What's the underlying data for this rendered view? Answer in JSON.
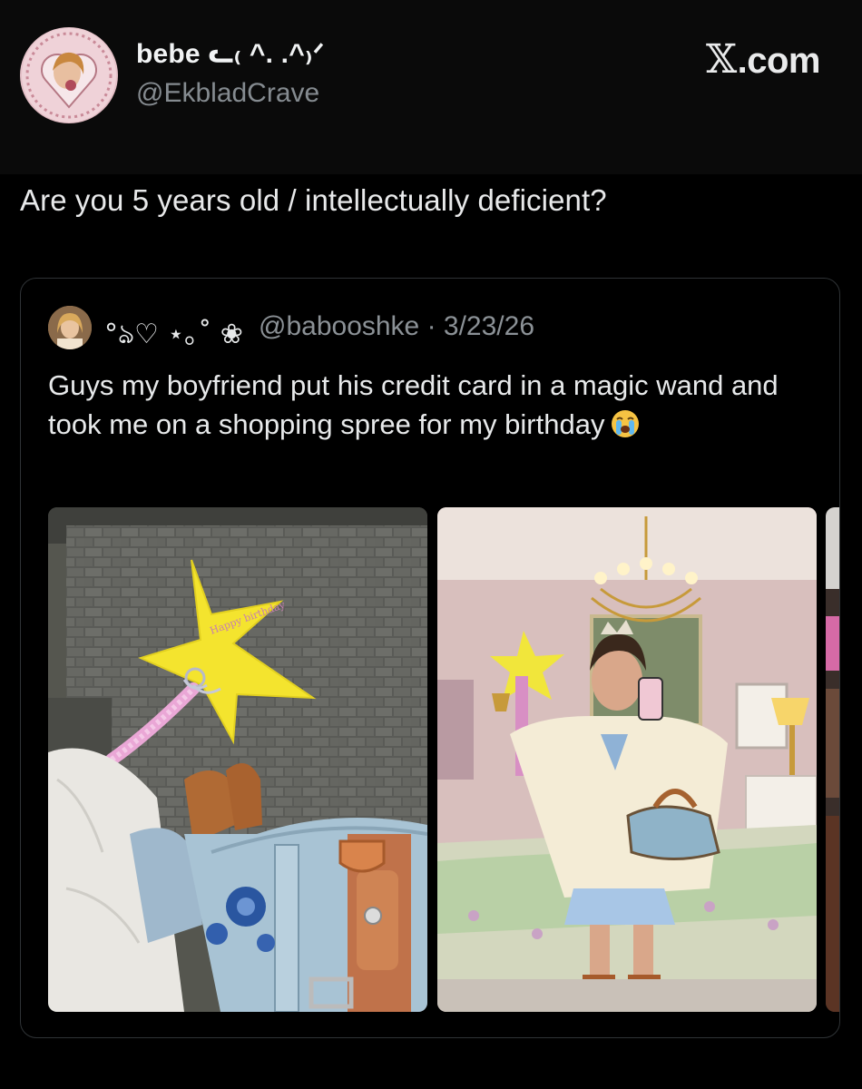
{
  "tweet": {
    "display_name": "bebe ᓚ₍ ^. .^₎ᐟ",
    "handle": "@EkbladCrave",
    "brand": "X.com",
    "text": "Are you 5 years old / intellectually deficient?"
  },
  "quoted_tweet": {
    "display_name": "°ঌ♡ ⋆｡˚ ❀",
    "handle_date": "@babooshke · 3/23/26",
    "text": "Guys my boyfriend put his credit card in a magic wand and took me on a shopping spree for my birthday",
    "emoji": "loudly-crying-face-emoji",
    "star_note": "Happy birthday",
    "images": [
      {
        "name": "wand-and-boots-photo"
      },
      {
        "name": "bedroom-mirror-selfie-photo"
      },
      {
        "name": "third-photo-partial"
      }
    ]
  },
  "colors": {
    "background": "#000000",
    "text": "#e7e9ea",
    "muted": "#858b90",
    "border": "#2f3336"
  }
}
